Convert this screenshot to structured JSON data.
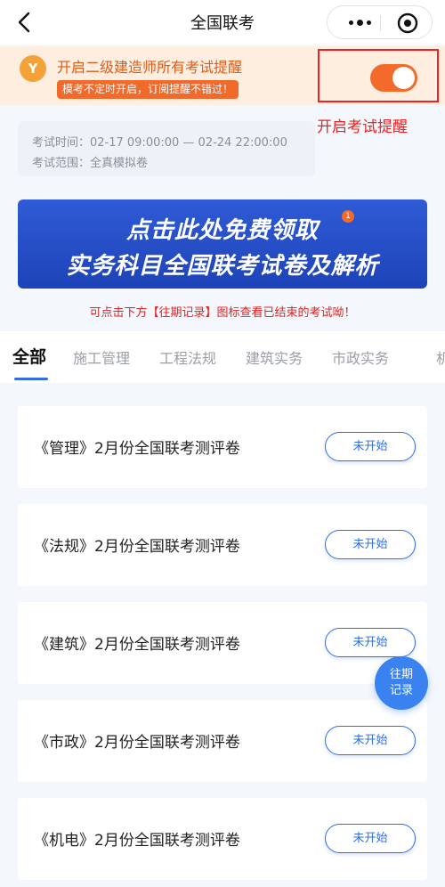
{
  "nav": {
    "title": "全国联考"
  },
  "remind": {
    "logo": "Y",
    "title": "开启二级建造师所有考试提醒",
    "sub": "模考不定时开启，订阅提醒不错过！",
    "toggle_on": true,
    "annotation": "开启考试提醒"
  },
  "exam": {
    "time": "考试时间：02-17 09:00:00 — 02-24 22:00:00",
    "scope": "考试范围：全真模拟卷"
  },
  "banner": {
    "line1": "点击此处免费领取",
    "line2": "实务科目全国联考试卷及解析",
    "badge": "1"
  },
  "notice": "可点击下方【往期记录】图标查看已结束的考试呦！",
  "tabs": [
    {
      "label": "全部",
      "active": true
    },
    {
      "label": "施工管理",
      "active": false
    },
    {
      "label": "工程法规",
      "active": false
    },
    {
      "label": "建筑实务",
      "active": false
    },
    {
      "label": "市政实务",
      "active": false
    },
    {
      "label": "机",
      "active": false
    }
  ],
  "items": [
    {
      "title": "《管理》2月份全国联考测评卷",
      "status": "未开始"
    },
    {
      "title": "《法规》2月份全国联考测评卷",
      "status": "未开始"
    },
    {
      "title": "《建筑》2月份全国联考测评卷",
      "status": "未开始"
    },
    {
      "title": "《市政》2月份全国联考测评卷",
      "status": "未开始"
    },
    {
      "title": "《机电》2月份全国联考测评卷",
      "status": "未开始"
    }
  ],
  "history": {
    "line1": "往期",
    "line2": "记录"
  },
  "colors": {
    "accent": "#2f6ee8",
    "orange": "#f36a2a",
    "alert": "#ee2222"
  }
}
